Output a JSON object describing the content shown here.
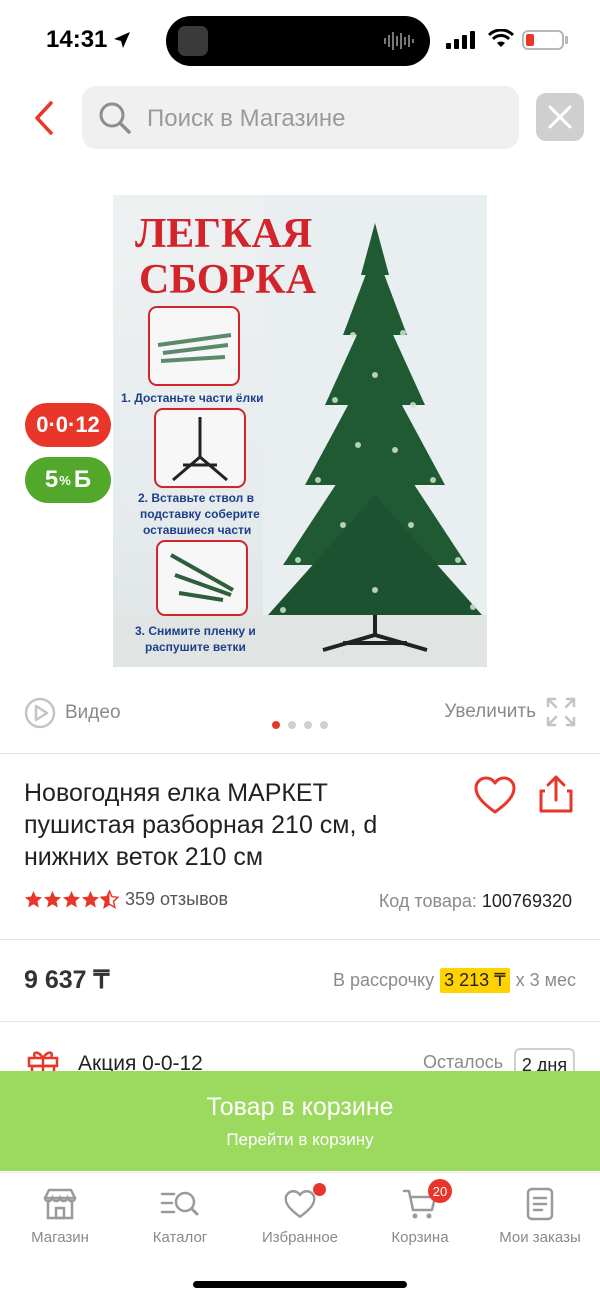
{
  "status_bar": {
    "time": "14:31"
  },
  "search": {
    "placeholder": "Поиск в Магазине"
  },
  "image_badges": {
    "promo": "0·0·12",
    "bonus_value": "5",
    "bonus_unit": "%",
    "bonus_currency": "Б"
  },
  "product_image": {
    "headline_1": "ЛЕГКАЯ",
    "headline_2": "СБОРКА",
    "step_1": "1. Достаньте части ёлки",
    "step_2": "2. Вставьте ствол в подставку соберите оставшиеся части",
    "step_3": "3. Снимите пленку и распушите ветки"
  },
  "media": {
    "video_label": "Видео",
    "zoom_label": "Увеличить",
    "carousel": {
      "total": 4,
      "active": 1
    }
  },
  "product": {
    "title": "Новогодняя елка МАРКЕТ пушистая разборная 210 см, d нижних веток 210 см",
    "rating": 4.5,
    "reviews": "359 отзывов",
    "sku_label": "Код товара:",
    "sku_value": "100769320",
    "price": "9 637 ₸",
    "installment_prefix": "В рассрочку",
    "installment_amount": "3 213 ₸",
    "installment_suffix": "x 3 мес"
  },
  "promo": {
    "label": "Акция 0-0-12",
    "remaining_label": "Осталось",
    "days": "2 дня"
  },
  "cart_banner": {
    "title": "Товар в корзине",
    "subtitle": "Перейти в корзину"
  },
  "tabs": [
    {
      "label": "Магазин",
      "icon": "store-icon"
    },
    {
      "label": "Каталог",
      "icon": "catalog-search-icon"
    },
    {
      "label": "Избранное",
      "icon": "heart-icon",
      "dot": true
    },
    {
      "label": "Корзина",
      "icon": "cart-icon",
      "count": "20"
    },
    {
      "label": "Мои заказы",
      "icon": "orders-icon"
    }
  ],
  "colors": {
    "accent_red": "#e8362a",
    "bonus_green": "#52a82b",
    "cart_banner_green": "#9bd95f",
    "installment_yellow": "#ffd200"
  }
}
